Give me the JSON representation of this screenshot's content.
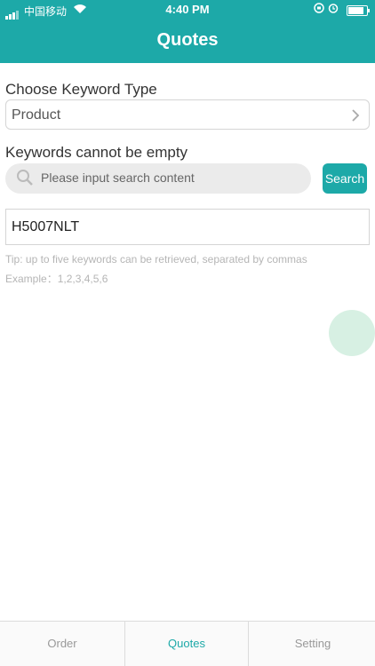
{
  "status_bar": {
    "carrier": "中国移动",
    "time": "4:40 PM"
  },
  "header": {
    "title": "Quotes"
  },
  "form": {
    "keyword_type_label": "Choose Keyword Type",
    "keyword_type_value": "Product",
    "keywords_label": "Keywords cannot be empty",
    "search_placeholder": "Please input search content",
    "search_button": "Search",
    "keyword_value": "H5007NLT",
    "tip": "Tip: up to five keywords can be retrieved, separated by commas",
    "example": "Example：1,2,3,4,5,6"
  },
  "tabs": [
    {
      "label": "Order",
      "active": false
    },
    {
      "label": "Quotes",
      "active": true
    },
    {
      "label": "Setting",
      "active": false
    }
  ],
  "colors": {
    "brand": "#1da9a8",
    "floating_button": "#d7f0e3"
  }
}
